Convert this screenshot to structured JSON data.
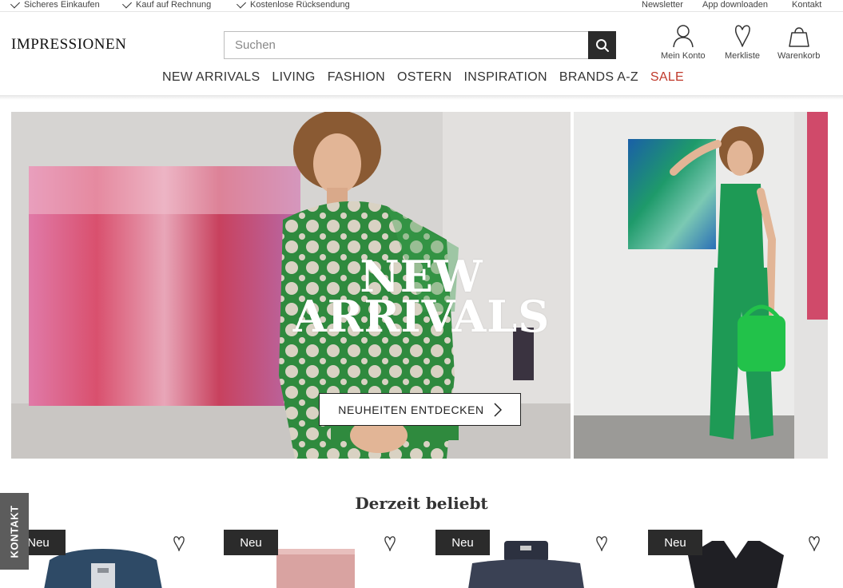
{
  "topbar": {
    "usps": [
      "Sicheres Einkaufen",
      "Kauf auf Rechnung",
      "Kostenlose Rücksendung"
    ],
    "links": [
      "Newsletter",
      "App downloaden",
      "Kontakt"
    ]
  },
  "header": {
    "logo": "IMPRESSIONEN",
    "search": {
      "placeholder": "Suchen"
    },
    "icons": [
      {
        "icon": "user-icon",
        "label": "Mein Konto"
      },
      {
        "icon": "heart-icon",
        "label": "Merkliste"
      },
      {
        "icon": "bag-icon",
        "label": "Warenkorb"
      }
    ]
  },
  "nav": [
    "NEW ARRIVALS",
    "LIVING",
    "FASHION",
    "OSTERN",
    "INSPIRATION",
    "BRANDS A-Z",
    "SALE"
  ],
  "hero": {
    "title_line1": "NEW",
    "title_line2": "ARRIVALS",
    "button": "NEUHEITEN ENTDECKEN"
  },
  "popular": {
    "title": "Derzeit beliebt",
    "products": [
      {
        "badge": "Neu"
      },
      {
        "badge": "Neu"
      },
      {
        "badge": "Neu"
      },
      {
        "badge": "Neu"
      }
    ]
  },
  "contact_tab": "KONTAKT",
  "colors": {
    "sale": "#c0392b",
    "dark": "#2b2b2b",
    "sweater_green": "#2f8a3e",
    "lace_green": "#1e9a55"
  }
}
